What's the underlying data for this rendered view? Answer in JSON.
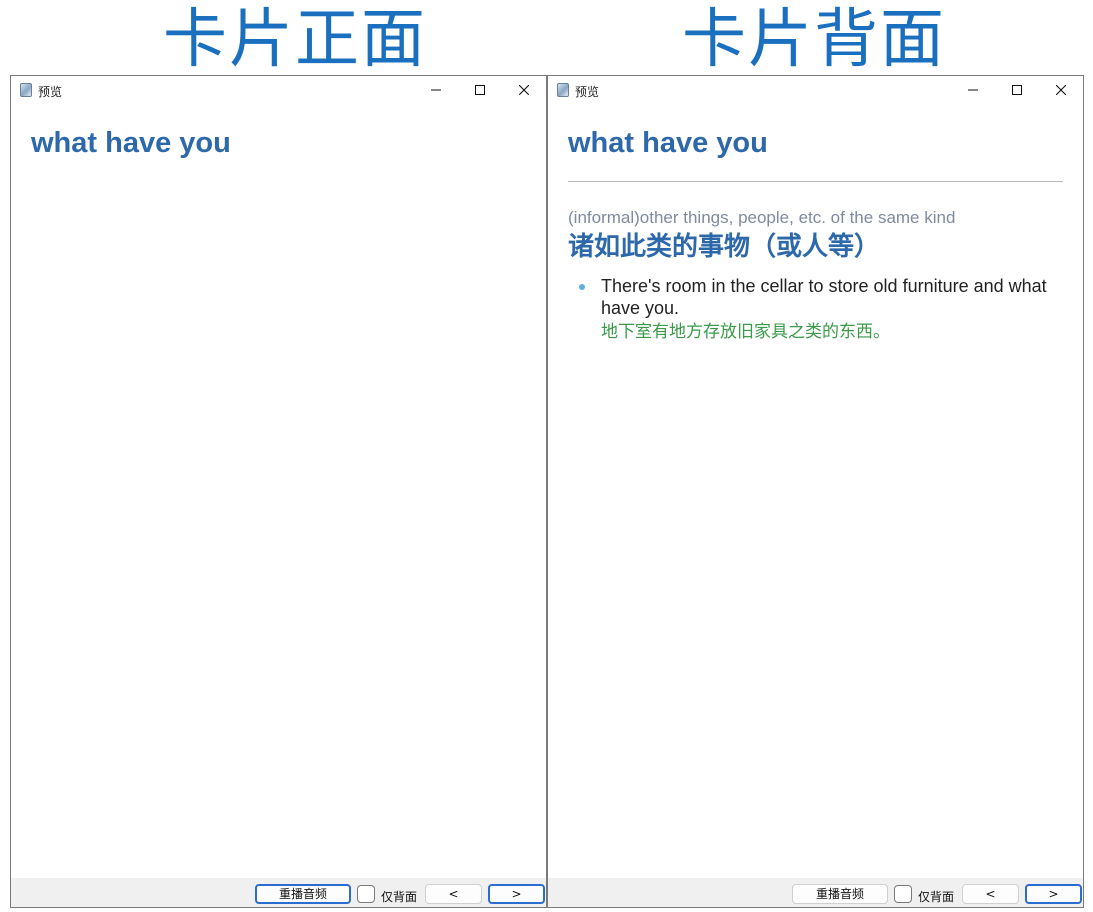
{
  "headings": {
    "front": "卡片正面",
    "back": "卡片背面"
  },
  "front_window": {
    "title": "预览",
    "word": "what have you",
    "controls": {
      "replay_audio": "重播音频",
      "back_only": "仅背面",
      "prev": "<",
      "next": ">"
    }
  },
  "back_window": {
    "title": "预览",
    "word": "what have you",
    "sense": "(informal)other things, people, etc. of the same kind",
    "chinese_definition": "诸如此类的事物（或人等）",
    "example_en": "There's room in the cellar to store old furniture and what have you.",
    "example_zh": "地下室有地方存放旧家具之类的东西。",
    "controls": {
      "replay_audio": "重播音频",
      "back_only": "仅背面",
      "prev": "<",
      "next": ">"
    }
  },
  "icons": [
    "app-icon",
    "minimize-icon",
    "maximize-icon",
    "close-icon",
    "bullet-icon"
  ],
  "colors": {
    "heading": "#1a6fbf",
    "word": "#2d68aa",
    "sense": "#7f8aa0",
    "example_zh": "#3a9a4a",
    "bullet": "#5aaee6",
    "focus": "#2b6ccf"
  }
}
